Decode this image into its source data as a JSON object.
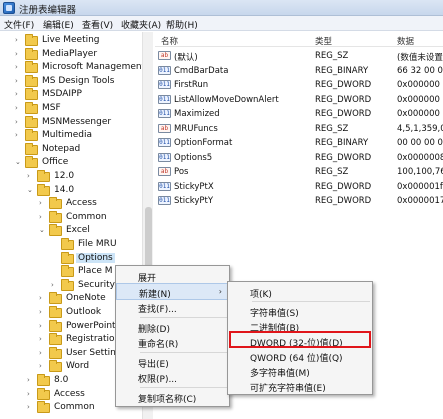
{
  "window": {
    "title": "注册表编辑器"
  },
  "menubar": [
    "文件(F)",
    "编辑(E)",
    "查看(V)",
    "收藏夹(A)",
    "帮助(H)"
  ],
  "tree": [
    {
      "label": "Live Meeting",
      "arrow": "›"
    },
    {
      "label": "MediaPlayer",
      "arrow": "›"
    },
    {
      "label": "Microsoft Management C",
      "arrow": "›"
    },
    {
      "label": "MS Design Tools",
      "arrow": "›"
    },
    {
      "label": "MSDAIPP",
      "arrow": "›"
    },
    {
      "label": "MSF",
      "arrow": "›"
    },
    {
      "label": "MSNMessenger",
      "arrow": "›"
    },
    {
      "label": "Multimedia",
      "arrow": "›"
    },
    {
      "label": "Notepad",
      "arrow": ""
    },
    {
      "label": "Office",
      "arrow": "⌄"
    },
    {
      "label": "12.0",
      "arrow": "›"
    },
    {
      "label": "14.0",
      "arrow": "⌄"
    },
    {
      "label": "Access",
      "arrow": "›"
    },
    {
      "label": "Common",
      "arrow": "›"
    },
    {
      "label": "Excel",
      "arrow": "⌄"
    },
    {
      "label": "File MRU",
      "arrow": ""
    },
    {
      "label": "Options",
      "arrow": ""
    },
    {
      "label": "Place M",
      "arrow": ""
    },
    {
      "label": "Security",
      "arrow": "›"
    },
    {
      "label": "OneNote",
      "arrow": "›"
    },
    {
      "label": "Outlook",
      "arrow": "›"
    },
    {
      "label": "PowerPoint",
      "arrow": "›"
    },
    {
      "label": "Registration",
      "arrow": "›"
    },
    {
      "label": "User Setting",
      "arrow": "›"
    },
    {
      "label": "Word",
      "arrow": "›"
    },
    {
      "label": "8.0",
      "arrow": "›"
    },
    {
      "label": "Access",
      "arrow": "›"
    },
    {
      "label": "Common",
      "arrow": "›"
    }
  ],
  "list": {
    "headers": {
      "name": "名称",
      "type": "类型",
      "data": "数据"
    },
    "rows": [
      {
        "icon": "ab",
        "name": "(默认)",
        "type": "REG_SZ",
        "data": "(数值未设置"
      },
      {
        "icon": "011",
        "name": "CmdBarData",
        "type": "REG_BINARY",
        "data": "66 32 00 0"
      },
      {
        "icon": "011",
        "name": "FirstRun",
        "type": "REG_DWORD",
        "data": "0x000000"
      },
      {
        "icon": "011",
        "name": "ListAllowMoveDownAlert",
        "type": "REG_DWORD",
        "data": "0x000000"
      },
      {
        "icon": "011",
        "name": "Maximized",
        "type": "REG_DWORD",
        "data": "0x000000"
      },
      {
        "icon": "ab",
        "name": "MRUFuncs",
        "type": "REG_SZ",
        "data": "4,5,1,359,0,"
      },
      {
        "icon": "011",
        "name": "OptionFormat",
        "type": "REG_BINARY",
        "data": "00 00 00 0"
      },
      {
        "icon": "011",
        "name": "Options5",
        "type": "REG_DWORD",
        "data": "0x0000008"
      },
      {
        "icon": "ab",
        "name": "Pos",
        "type": "REG_SZ",
        "data": "100,100,76"
      },
      {
        "icon": "011",
        "name": "StickyPtX",
        "type": "REG_DWORD",
        "data": "0x000001f"
      },
      {
        "icon": "011",
        "name": "StickyPtY",
        "type": "REG_DWORD",
        "data": "0x0000017"
      }
    ]
  },
  "context_menu": {
    "items": [
      "展开",
      "新建(N)",
      "查找(F)...",
      "删除(D)",
      "重命名(R)",
      "导出(E)",
      "权限(P)...",
      "复制项名称(C)"
    ],
    "submenu_arrow": "›"
  },
  "submenu": {
    "items": [
      "项(K)",
      "字符串值(S)",
      "二进制值(B)",
      "DWORD (32-位)值(D)",
      "QWORD (64 位)值(Q)",
      "多字符串值(M)",
      "可扩充字符串值(E)"
    ]
  },
  "colors": {
    "highlight_box": "#e0151a",
    "folder": "#f2c94c",
    "selection": "#cce4f7"
  }
}
